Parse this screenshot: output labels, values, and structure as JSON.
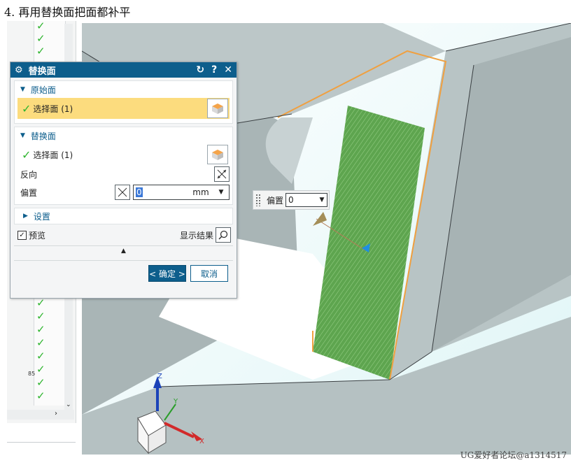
{
  "caption": "4. 再用替换面把面都补平",
  "watermark": "UG爱好者论坛@a1314517",
  "navigator": {
    "check_glyph": "✓",
    "partial_label": "85"
  },
  "dialog": {
    "title": "替换面",
    "controls": {
      "reset": "↻",
      "help": "?",
      "close": "✕"
    },
    "original_face": {
      "header": "原始面",
      "select_label": "选择面 (1)"
    },
    "replacement_face": {
      "header": "替换面",
      "select_label": "选择面 (1)",
      "reverse_label": "反向",
      "offset_label": "偏置",
      "offset_value": "0",
      "offset_unit": "mm"
    },
    "settings_label": "设置",
    "preview_label": "预览",
    "show_result_label": "显示结果",
    "ok_label": "< 确定 >",
    "cancel_label": "取消"
  },
  "floating_offset": {
    "label": "偏置",
    "value": "0"
  },
  "axes": {
    "x": "X",
    "y": "Y",
    "z": "Z"
  },
  "colors": {
    "accent": "#0d5e8c",
    "highlight": "#fcdc7e",
    "selected_face": "#5ea54f",
    "edge": "#f0a040",
    "model_gray": "#b7c3c4",
    "background_cyan": "#e9f9f9"
  }
}
